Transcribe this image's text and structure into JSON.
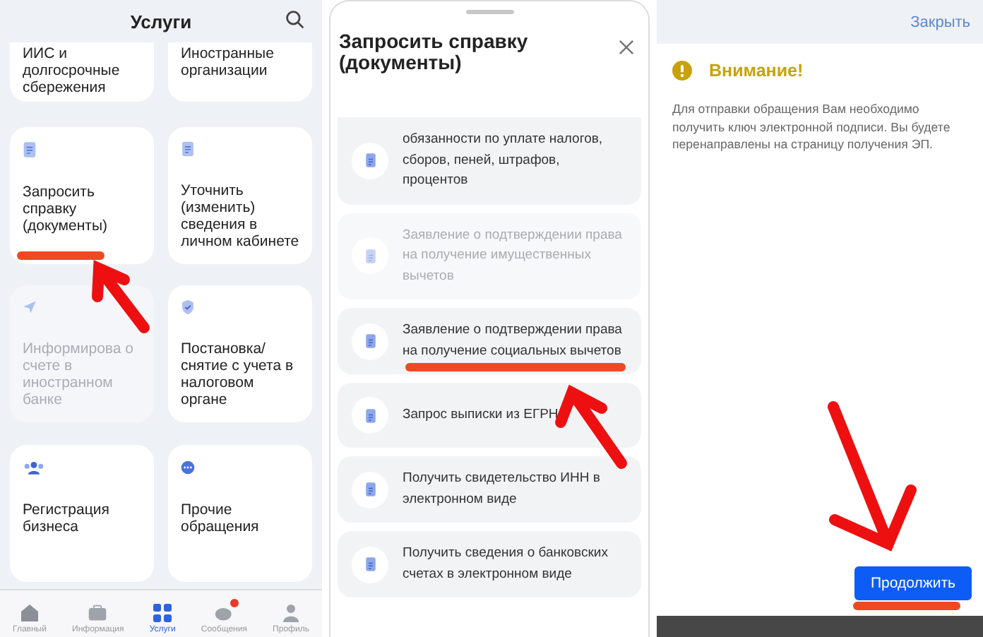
{
  "services_screen": {
    "title": "Услуги",
    "tiles": [
      {
        "label": "ИИС и долгосрочные сбережения",
        "kind": "none",
        "disabled": false,
        "highlighted": false
      },
      {
        "label": "Иностранные организации",
        "kind": "none",
        "disabled": false,
        "highlighted": false
      },
      {
        "label": "Запросить справку (документы)",
        "kind": "document",
        "disabled": false,
        "highlighted": true
      },
      {
        "label": "Уточнить (изменить) сведения в личном кабинете",
        "kind": "document",
        "disabled": false,
        "highlighted": false
      },
      {
        "label": "Информирова о счете в иностранном банке",
        "kind": "send",
        "disabled": true,
        "highlighted": false
      },
      {
        "label": "Постановка/ снятие с учета в налоговом органе",
        "kind": "shield",
        "disabled": false,
        "highlighted": false
      },
      {
        "label": "Регистрация бизнеса",
        "kind": "people",
        "disabled": false,
        "highlighted": false
      },
      {
        "label": "Прочие обращения",
        "kind": "more",
        "disabled": false,
        "highlighted": false
      }
    ],
    "nav": [
      {
        "label": "Главный",
        "kind": "home",
        "selected": false,
        "badge": false
      },
      {
        "label": "Информация",
        "kind": "info",
        "selected": false,
        "badge": false
      },
      {
        "label": "Услуги",
        "kind": "grid",
        "selected": true,
        "badge": false
      },
      {
        "label": "Сообщения",
        "kind": "chat",
        "selected": false,
        "badge": true
      },
      {
        "label": "Профиль",
        "kind": "person",
        "selected": false,
        "badge": false
      }
    ]
  },
  "request_sheet": {
    "title": "Запросить справку (документы)",
    "items": [
      {
        "label": "обязанности по уплате налогов, сборов, пеней, штрафов, процентов",
        "disabled": false,
        "highlighted": false
      },
      {
        "label": "Заявление о подтверждении права на получение имущественных вычетов",
        "disabled": true,
        "highlighted": false
      },
      {
        "label": "Заявление о подтверждении права на получение социальных вычетов",
        "disabled": false,
        "highlighted": true
      },
      {
        "label": "Запрос выписки из ЕГРН",
        "disabled": false,
        "highlighted": false
      },
      {
        "label": "Получить свидетельство ИНН в электронном виде",
        "disabled": false,
        "highlighted": false
      },
      {
        "label": "Получить сведения о банковских счетах в электронном виде",
        "disabled": false,
        "highlighted": false
      }
    ]
  },
  "warning_screen": {
    "close": "Закрыть",
    "title": "Внимание!",
    "message": "Для отправки обращения Вам необходимо получить ключ электронной подписи. Вы будете перенаправлены на страницу получения ЭП.",
    "button": "Продолжить",
    "button_highlighted": true
  }
}
